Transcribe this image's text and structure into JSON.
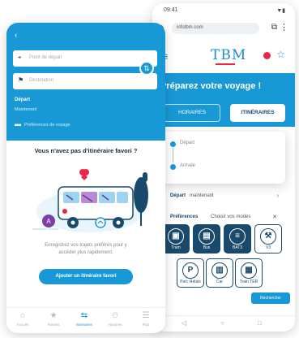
{
  "back_phone": {
    "status": {
      "time": "09:41",
      "icons": "▼▮"
    },
    "url_bar": {
      "url": "infotbm.com",
      "home_icon": "home-icon",
      "tabs_label": "⧉",
      "menu_label": "⋮"
    },
    "brand": {
      "logo": "TBM",
      "burger": "≡",
      "star": "☆"
    },
    "title": "Préparez votre voyage !",
    "tabs": [
      "HORAIRES",
      "ITINÉRAIRES"
    ],
    "route": {
      "from": "Départ",
      "to": "Arrivée"
    },
    "depart": {
      "label": "Départ",
      "value": "maintenant",
      "chevron": "›"
    },
    "prefs": {
      "label": "Préférences",
      "value": "Choisir vos modes",
      "clear": "✕"
    },
    "modes": [
      {
        "icon": "▣",
        "label": "Tram"
      },
      {
        "icon": "▤",
        "label": "Bus"
      },
      {
        "icon": "≡",
        "label": "BAT3"
      },
      {
        "icon": "⚒",
        "label": "V3"
      },
      {
        "icon": "P",
        "label": "Parc Relais"
      },
      {
        "icon": "▥",
        "label": "Car"
      },
      {
        "icon": "▦",
        "label": "Train TER"
      }
    ],
    "fab": "Rechercher",
    "nav": [
      "◁",
      "○",
      "□"
    ]
  },
  "front_phone": {
    "back_label": "‹",
    "from_placeholder": "Point de départ",
    "to_placeholder": "Destination",
    "swap": "⇅",
    "depart_label": "Départ",
    "depart_time": "Maintenant",
    "prefs": "Préférences de voyage",
    "empty_title": "Vous n'avez pas d'itinéraire favori ?",
    "empty_message": "Enregistrez vos trajets préférés pour y accéder plus rapidement.",
    "cta": "Ajouter un itinéraire favori",
    "nav": [
      {
        "icon": "⌂",
        "label": "Accueil"
      },
      {
        "icon": "★",
        "label": "Favoris"
      },
      {
        "icon": "⇆",
        "label": "Itinéraires",
        "active": true
      },
      {
        "icon": "⏲",
        "label": "Horaires"
      },
      {
        "icon": "☰",
        "label": "Plus"
      }
    ]
  },
  "colors": {
    "primary": "#1899d6",
    "navy": "#1a4a6b",
    "accent": "#e8274a"
  }
}
